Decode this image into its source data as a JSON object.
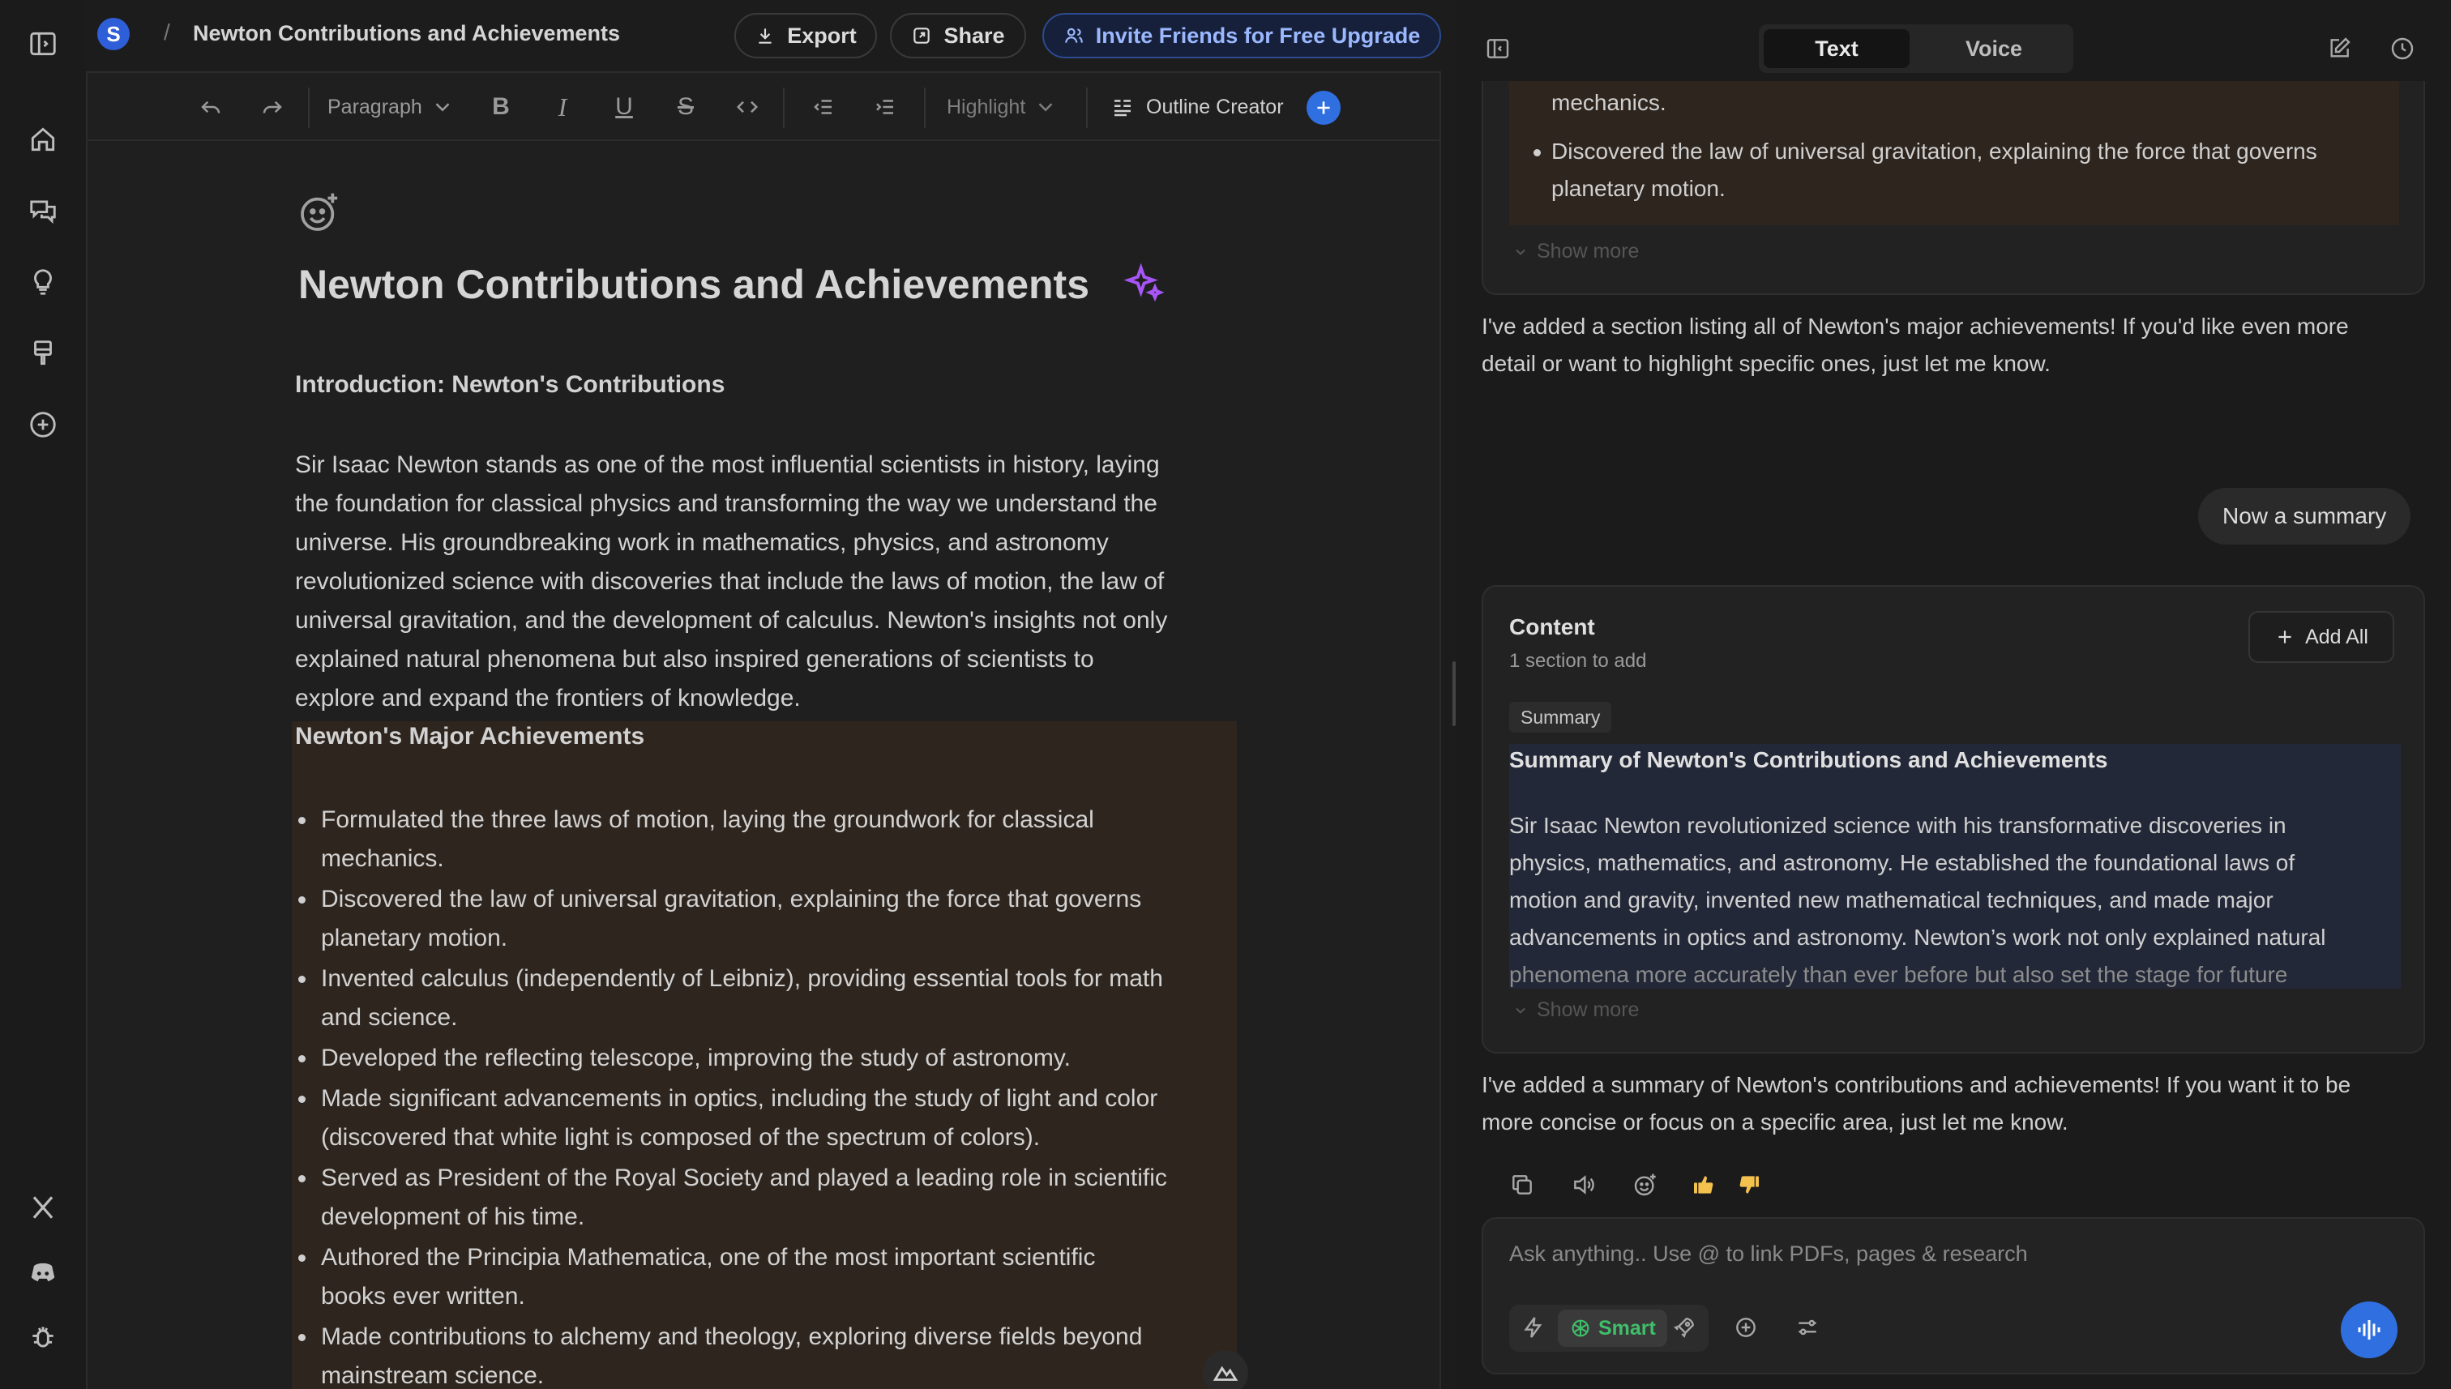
{
  "breadcrumb": {
    "separator": "/",
    "title": "Newton Contributions and Achievements",
    "workspace_initial": "S"
  },
  "header": {
    "export_label": "Export",
    "share_label": "Share",
    "invite_label": "Invite Friends for Free Upgrade"
  },
  "toolbar": {
    "block_type": "Paragraph",
    "highlight_label": "Highlight",
    "outline_label": "Outline Creator"
  },
  "document": {
    "title": "Newton Contributions and Achievements",
    "intro_heading": "Introduction: Newton's Contributions",
    "intro_lines": [
      "Sir Isaac Newton stands as one of the most influential scientists in history, laying",
      "the foundation for classical physics and transforming the way we understand the",
      "universe. His groundbreaking work in mathematics, physics, and astronomy",
      "revolutionized science with discoveries that include the laws of motion, the law of",
      "universal gravitation, and the development of calculus. Newton's insights not only",
      "explained natural phenomena but also inspired generations of scientists to",
      "explore and expand the frontiers of knowledge."
    ],
    "achievements_heading": "Newton's Major Achievements",
    "achievements": [
      [
        "Formulated the three laws of motion, laying the groundwork for classical",
        "mechanics."
      ],
      [
        "Discovered the law of universal gravitation, explaining the force that governs",
        "planetary motion."
      ],
      [
        "Invented calculus (independently of Leibniz), providing essential tools for math",
        "and science."
      ],
      [
        "Developed the reflecting telescope, improving the study of astronomy."
      ],
      [
        "Made significant advancements in optics, including the study of light and color",
        "(discovered that white light is composed of the spectrum of colors)."
      ],
      [
        "Served as President of the Royal Society and played a leading role in scientific",
        "development of his time."
      ],
      [
        "Authored the Principia Mathematica, one of the most important scientific",
        "books ever written."
      ],
      [
        "Made contributions to alchemy and theology, exploring diverse fields beyond",
        "mainstream science."
      ]
    ]
  },
  "chat": {
    "mode_tabs": [
      "Text",
      "Voice"
    ],
    "active_mode": "Text",
    "prev_card": {
      "lines": [
        "mechanics.",
        "Discovered the law of universal gravitation, explaining the force that governs",
        "planetary motion."
      ],
      "show_more": "Show more"
    },
    "reply_1": [
      "I've added a section listing all of Newton's major achievements! If you'd like even more",
      "detail or want to highlight specific ones, just let me know."
    ],
    "user_message": "Now a summary",
    "content_card": {
      "title": "Content",
      "subtitle": "1 section to add",
      "add_all_label": "Add All",
      "tag": "Summary",
      "section_title": "Summary of Newton's Contributions and Achievements",
      "section_lines": [
        "Sir Isaac Newton revolutionized science with his transformative discoveries in",
        "physics, mathematics, and astronomy. He established the foundational laws of",
        "motion and gravity, invented new mathematical techniques, and made major",
        "advancements in optics and astronomy. Newton’s work not only explained natural",
        "phenomena more accurately than ever before but also set the stage for future"
      ],
      "show_more": "Show more"
    },
    "reply_2": [
      "I've added a summary of Newton's contributions and achievements! If you want it to be",
      "more concise or focus on a specific area, just let me know."
    ],
    "input_placeholder": "Ask anything.. Use @ to link PDFs, pages & research",
    "smart_label": "Smart"
  },
  "colors": {
    "accent": "#2f6fe0",
    "invite_text": "#9bb8ff",
    "highlight_bg": "#2e251e",
    "smart_green": "#3fbf6a",
    "sparkle": "#a855f7"
  }
}
